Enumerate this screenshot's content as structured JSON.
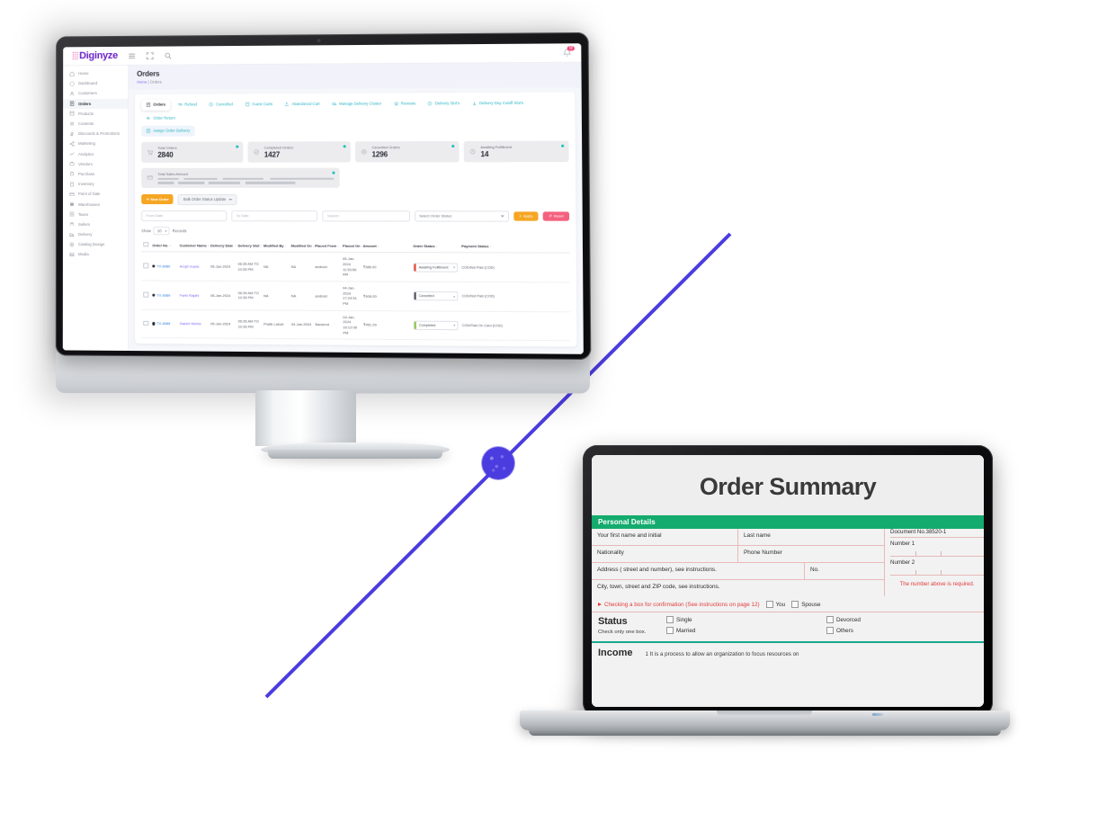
{
  "monitor": {
    "app": {
      "logo": "Diginyze",
      "header_icons": [
        "menu-icon",
        "fullscreen-icon",
        "search-icon"
      ],
      "notification_count": "12",
      "page_title": "Orders",
      "breadcrumb": {
        "home": "Home",
        "separator": "|",
        "current": "Orders"
      }
    },
    "sidebar": [
      {
        "label": "Home",
        "icon": "home-icon",
        "active": false
      },
      {
        "label": "Dashboard",
        "icon": "dashboard-icon",
        "active": false
      },
      {
        "label": "Customers",
        "icon": "customers-icon",
        "active": false
      },
      {
        "label": "Orders",
        "icon": "orders-icon",
        "active": true
      },
      {
        "label": "Products",
        "icon": "products-icon",
        "active": false
      },
      {
        "label": "Contents",
        "icon": "contents-icon",
        "active": false
      },
      {
        "label": "Discounts & Promotions",
        "icon": "discounts-icon",
        "active": false
      },
      {
        "label": "Marketing",
        "icon": "marketing-icon",
        "active": false
      },
      {
        "label": "Analytics",
        "icon": "analytics-icon",
        "active": false
      },
      {
        "label": "Vendors",
        "icon": "vendors-icon",
        "active": false
      },
      {
        "label": "Purchase",
        "icon": "purchase-icon",
        "active": false
      },
      {
        "label": "Inventory",
        "icon": "inventory-icon",
        "active": false
      },
      {
        "label": "Point of Sale",
        "icon": "pos-icon",
        "active": false
      },
      {
        "label": "Warehouses",
        "icon": "warehouse-icon",
        "active": false
      },
      {
        "label": "Taxes",
        "icon": "taxes-icon",
        "active": false
      },
      {
        "label": "Sellers",
        "icon": "sellers-icon",
        "active": false
      },
      {
        "label": "Delivery",
        "icon": "delivery-icon",
        "active": false
      },
      {
        "label": "Catalog Design",
        "icon": "catalog-icon",
        "active": false
      },
      {
        "label": "Media",
        "icon": "media-icon",
        "active": false
      }
    ],
    "tabs": [
      {
        "label": "Orders",
        "icon": "orders-tab-icon",
        "active": true
      },
      {
        "label": "Refund",
        "icon": "refund-icon",
        "active": false
      },
      {
        "label": "Cancelled",
        "icon": "cancelled-icon",
        "active": false
      },
      {
        "label": "Guest Carts",
        "icon": "guest-cart-icon",
        "active": false
      },
      {
        "label": "Abandoned Cart",
        "icon": "abandoned-cart-icon",
        "active": false
      },
      {
        "label": "Manage Delivery Cluster",
        "icon": "cluster-icon",
        "active": false
      },
      {
        "label": "Reviews",
        "icon": "reviews-icon",
        "active": false
      },
      {
        "label": "Delivery Slot's",
        "icon": "delivery-slot-icon",
        "active": false
      },
      {
        "label": "Delivery Day Cutoff Slot's",
        "icon": "cutoff-icon",
        "active": false
      },
      {
        "label": "Order Return",
        "icon": "order-return-icon",
        "active": false
      }
    ],
    "subtab": {
      "label": "Assign Order Delivery",
      "icon": "assign-order-icon"
    },
    "stats": [
      {
        "label": "Total Orders",
        "value": "2840",
        "icon": "cart-icon"
      },
      {
        "label": "Completed Orders",
        "value": "1427",
        "icon": "check-icon"
      },
      {
        "label": "Cancelled Orders",
        "value": "1296",
        "icon": "cancel-icon"
      },
      {
        "label": "Awaiting Fulfillment",
        "value": "14",
        "icon": "clock-icon"
      }
    ],
    "sales_card": {
      "label": "Total Sales Amount",
      "icon": "wallet-icon"
    },
    "actions": {
      "new_order": "New Order",
      "new_order_icon": "plus-icon",
      "bulk_update": "Bulk Order Status Update"
    },
    "filters": {
      "from_date_placeholder": "From Date",
      "to_date_placeholder": "To Date",
      "search_placeholder": "Search",
      "status_select": "Select Order Status",
      "apply": "Apply",
      "apply_icon": "search-icon",
      "reset": "Reset",
      "reset_icon": "refresh-icon"
    },
    "show": {
      "prefix": "Show",
      "value": "10",
      "suffix": "Records"
    },
    "table": {
      "columns": [
        "Order No.",
        "Customer Name",
        "Delivery Date",
        "Delivery Slot",
        "Modified By",
        "Modified On",
        "Placed From",
        "Placed On",
        "Amount",
        "Order Status",
        "Payment Status"
      ],
      "rows": [
        {
          "order_no": "TX-8080",
          "customer": "Anujit Gupta",
          "delivery_date": "05-Jan-2024",
          "delivery_slot": "06:35 AM TO 10:35 PM",
          "modified_by": "NA",
          "modified_on": "NA",
          "placed_from": "android",
          "placed_on": "05-Jan-2024 11:53:56 AM",
          "amount": "₹386.00",
          "status": "Awaiting Fulfillment",
          "status_color": "#e8402f",
          "payment": "COD/Not Paid (COD)"
        },
        {
          "order_no": "TX-8089",
          "customer": "Parth Rajdhi",
          "delivery_date": "05-Jan-2024",
          "delivery_slot": "06:35 AM TO 10:35 PM",
          "modified_by": "NA",
          "modified_on": "NA",
          "placed_from": "android",
          "placed_on": "04-Jan-2024 17:24:51 PM",
          "amount": "₹406.00",
          "status": "Cancelled",
          "status_color": "#4a4e58",
          "payment": "COD/Not Paid (COD)"
        },
        {
          "order_no": "TX-8088",
          "customer": "Sakshi Mehta",
          "delivery_date": "05-Jan-2024",
          "delivery_slot": "06:35 AM TO 10:35 PM",
          "modified_by": "Pratik Lahoti",
          "modified_on": "04-Jan-2024",
          "placed_from": "Backend",
          "placed_on": "04-Jan-2024 16:12:08 PM",
          "amount": "₹451.00",
          "status": "Completed",
          "status_color": "#8dc63f",
          "payment": "COD/Paid On Card (COD)"
        }
      ]
    }
  },
  "laptop": {
    "doc": {
      "title": "Order Summary",
      "section_personal": "Personal Details",
      "fields": {
        "first_name": "Your first name and initial",
        "last_name": "Last name",
        "nationality": "Nationality",
        "phone": "Phone Number",
        "address": "Address ( street and number), see instructions.",
        "no": "No.",
        "city": "City, town, street and ZIP code, see instructions."
      },
      "right": {
        "document_no": "Document No.38520-1",
        "number1": "Number 1",
        "number2": "Number 2",
        "required_note": "The number above is required."
      },
      "confirm": {
        "text": "Checking a box for confirmation (See instructions on page 12)",
        "you": "You",
        "spouse": "Spouse"
      },
      "status": {
        "heading": "Status",
        "subtext": "Check only one box.",
        "options_left": [
          "Single",
          "Married"
        ],
        "options_right": [
          "Devorced",
          "Others"
        ]
      },
      "income": {
        "heading": "Income",
        "text": "1  It is a process to allow an organization to focus resources on"
      }
    }
  },
  "colors": {
    "accent_purple": "#6b23c9",
    "accent_indigo": "#4b3ce0",
    "accent_orange": "#f5a623",
    "accent_pink": "#f4617f",
    "accent_green": "#14ab6e",
    "accent_teal": "#17c2b8"
  }
}
